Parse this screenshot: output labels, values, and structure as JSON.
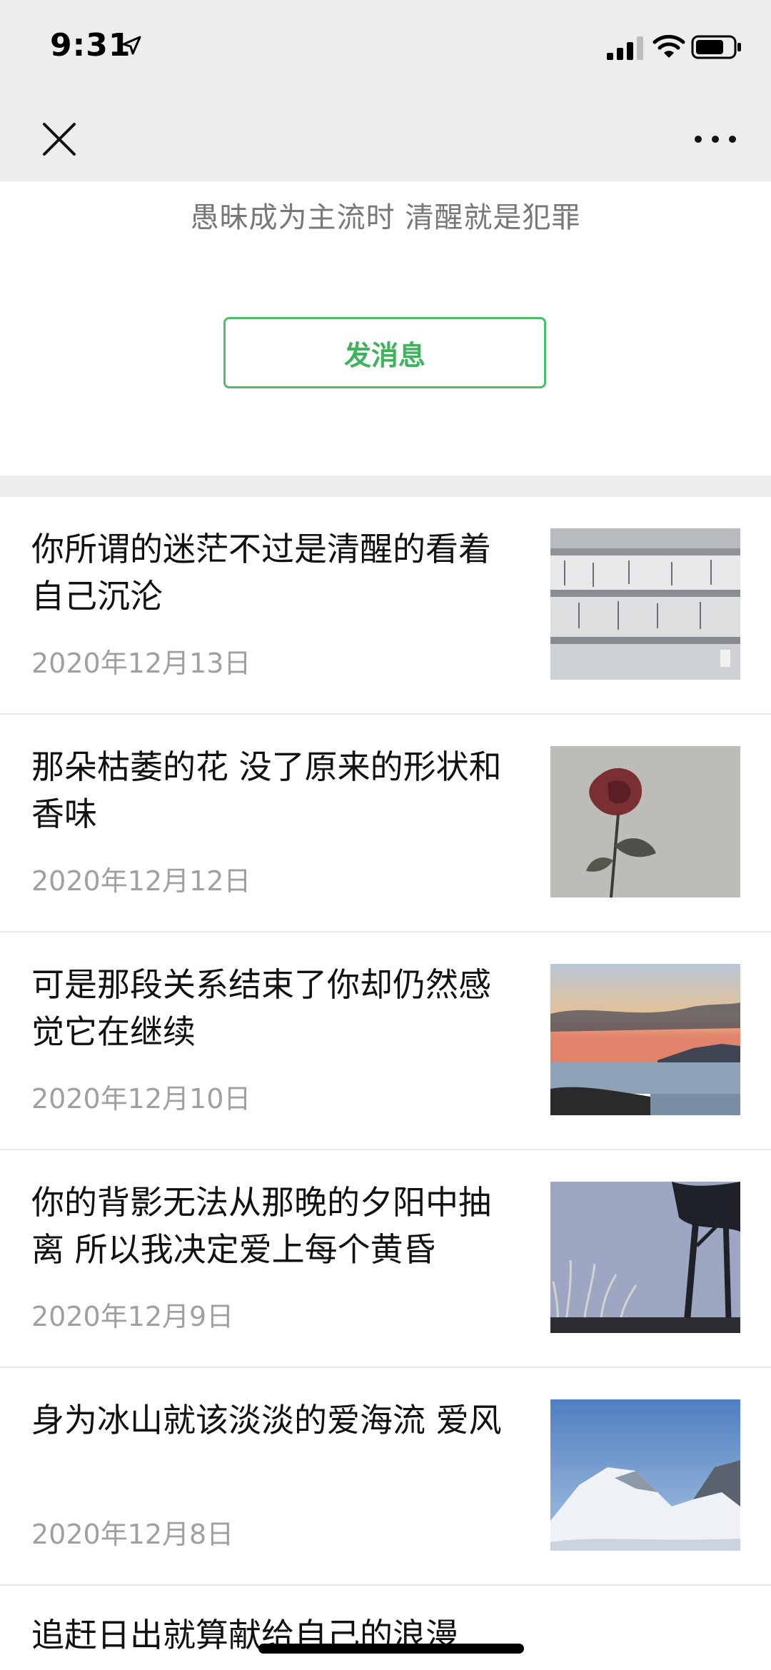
{
  "status_bar": {
    "time": "9:31"
  },
  "profile": {
    "signature": "愚昧成为主流时 清醒就是犯罪",
    "message_button_label": "发消息"
  },
  "articles": [
    {
      "title": "你所谓的迷茫不过是清醒的看着自己沉沦",
      "date": "2020年12月13日",
      "thumbnail": "shelves-photo"
    },
    {
      "title": "那朵枯萎的花 没了原来的形状和香味",
      "date": "2020年12月12日",
      "thumbnail": "rose-photo"
    },
    {
      "title": "可是那段关系结束了你却仍然感觉它在继续",
      "date": "2020年12月10日",
      "thumbnail": "sunset-sea-photo"
    },
    {
      "title": "你的背影无法从那晚的夕阳中抽离 所以我决定爱上每个黄昏",
      "date": "2020年12月9日",
      "thumbnail": "tree-silhouette-photo"
    },
    {
      "title": "身为冰山就该淡淡的爱海流 爱风",
      "date": "2020年12月8日",
      "thumbnail": "snow-mountain-photo"
    }
  ],
  "partial_article": {
    "title": "追赶日出就算献给自己的浪漫"
  }
}
